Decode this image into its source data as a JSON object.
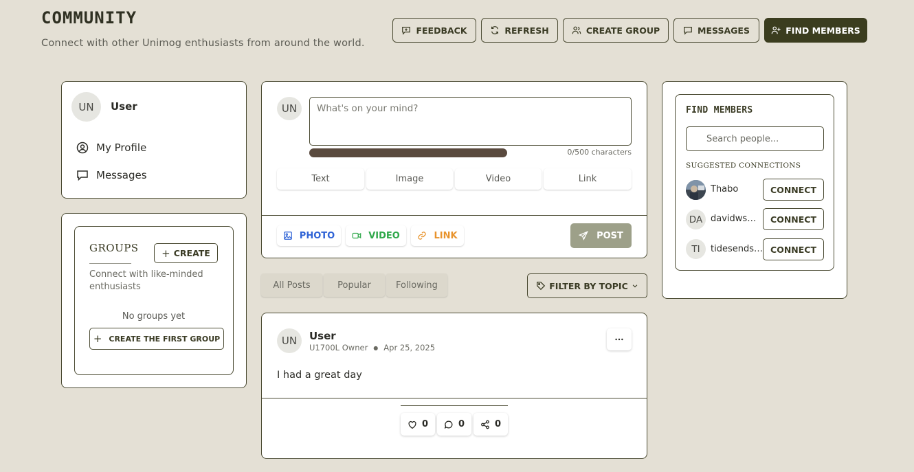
{
  "header": {
    "title": "COMMUNITY",
    "subtitle": "Connect with other Unimog enthusiasts from around the world.",
    "buttons": {
      "feedback": "FEEDBACK",
      "refresh": "REFRESH",
      "create_group": "CREATE GROUP",
      "messages": "MESSAGES",
      "find_members": "FIND MEMBERS"
    }
  },
  "profile_card": {
    "avatar_initials": "UN",
    "name": "User",
    "links": {
      "my_profile": "My Profile",
      "messages": "Messages"
    }
  },
  "groups": {
    "title": "GROUPS",
    "create_label": "CREATE",
    "description": "Connect with like-minded enthusiasts",
    "empty_text": "No groups yet",
    "create_first_label": "CREATE THE FIRST GROUP"
  },
  "composer": {
    "avatar_initials": "UN",
    "placeholder": "What's on your mind?",
    "char_count": "0/500 characters",
    "types": [
      "Text",
      "Image",
      "Video",
      "Link"
    ],
    "media": {
      "photo": "PHOTO",
      "video": "VIDEO",
      "link": "LINK"
    },
    "post_label": "POST",
    "colors": {
      "photo": "#2f63d6",
      "video": "#2fa84a",
      "link": "#e8932c",
      "post_bg": "#9da089",
      "progress": "#5a4a3e"
    }
  },
  "feed": {
    "tabs": [
      "All Posts",
      "Popular",
      "Following"
    ],
    "filter_label": "FILTER BY TOPIC"
  },
  "post": {
    "avatar_initials": "UN",
    "author": "User",
    "role": "U1700L Owner",
    "date": "Apr 25, 2025",
    "content": "I had a great day",
    "likes": "0",
    "comments": "0",
    "shares": "0"
  },
  "find_members": {
    "title": "FIND MEMBERS",
    "search_placeholder": "Search people...",
    "suggestions_title": "SUGGESTED CONNECTIONS",
    "connect_label": "CONNECT",
    "suggestions": [
      {
        "name": "Thabo",
        "initials": ""
      },
      {
        "name": "davidwswatson",
        "initials": "DA"
      },
      {
        "name": "tidesendsolutions",
        "initials": "TI"
      }
    ]
  }
}
